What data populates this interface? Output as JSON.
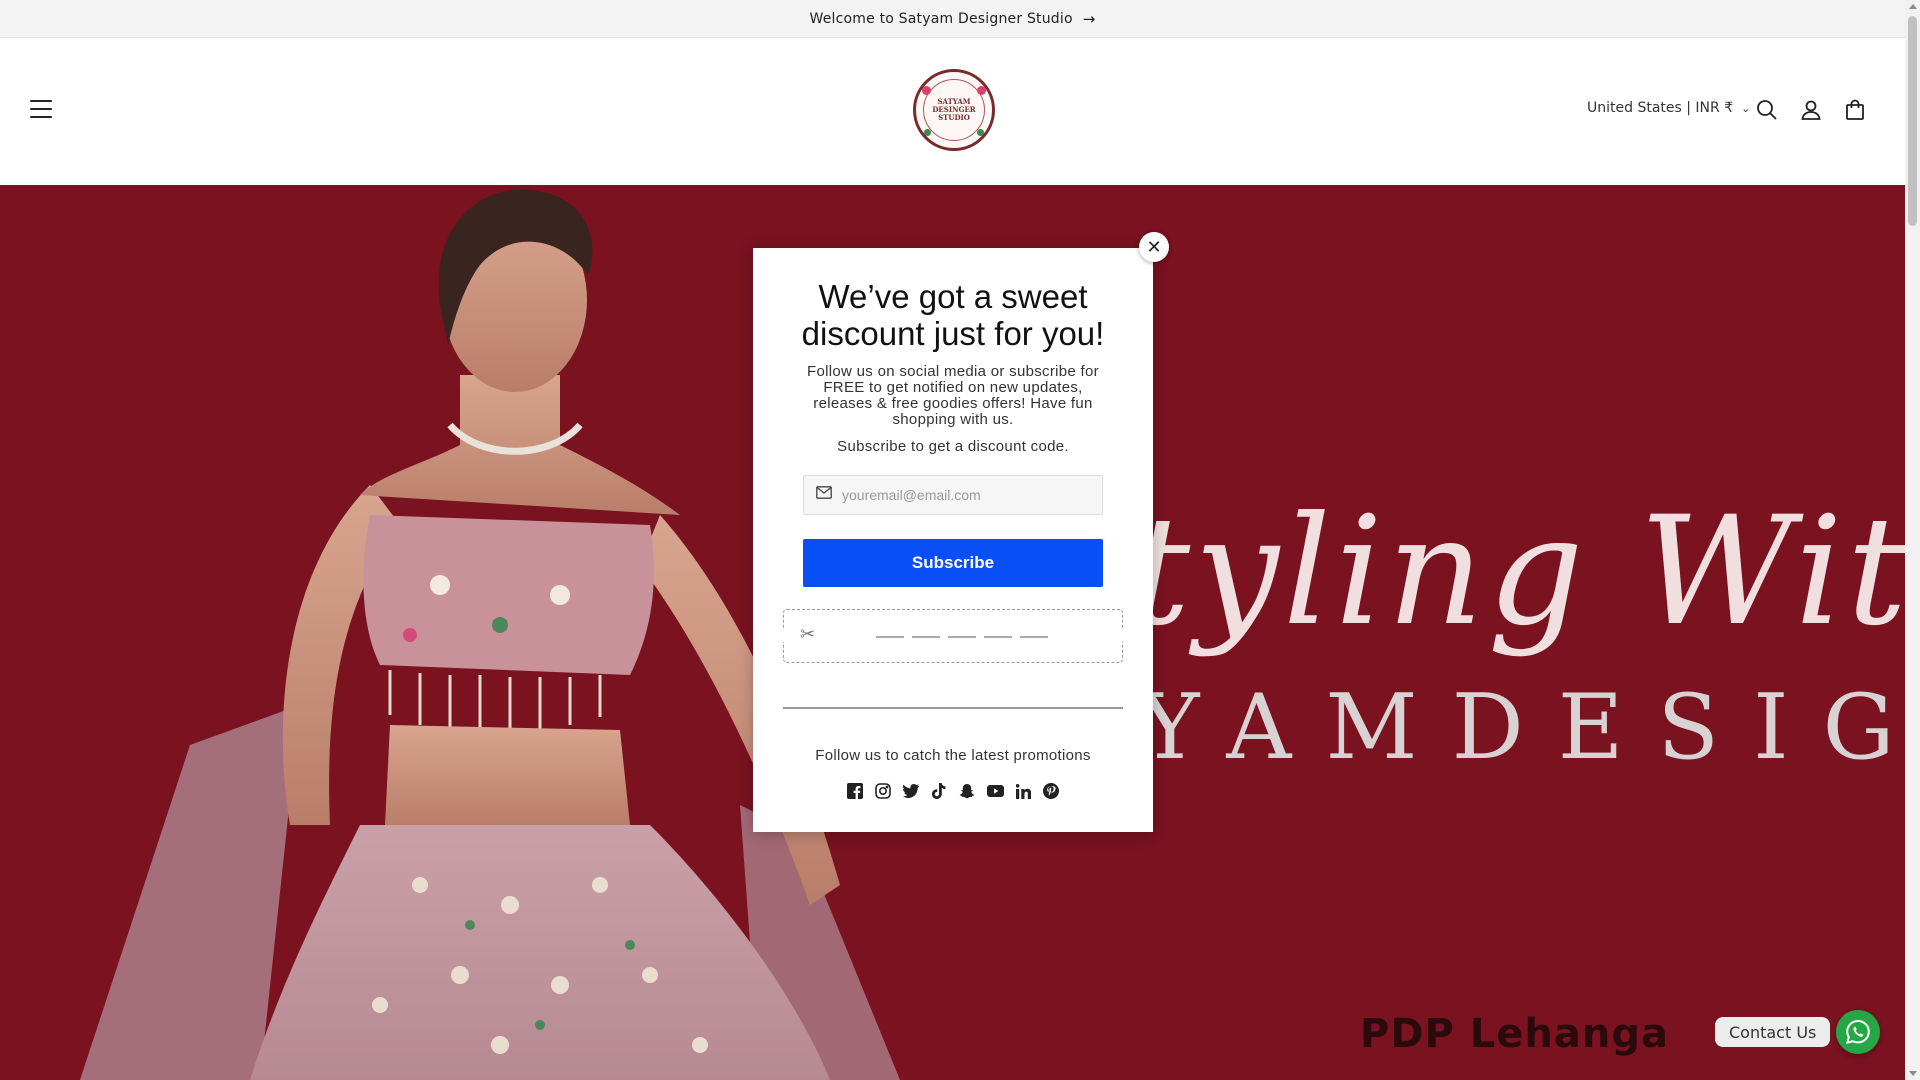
{
  "announcement": {
    "text": "Welcome to Satyam Designer Studio",
    "arrow": "→"
  },
  "header": {
    "menu_icon": "hamburger-menu-icon",
    "logo_text": [
      "SATYAM",
      "DESINGER",
      "STUDIO"
    ],
    "country_selector": "United States | INR ₹",
    "icons": [
      "search-icon",
      "account-icon",
      "cart-icon"
    ]
  },
  "hero": {
    "script_text": "tyling With",
    "brand_text": "YAMDESIGN",
    "caption": "PDP Lehanga",
    "background_color": "#7a1220"
  },
  "popup": {
    "close_symbol": "✕",
    "title": "We’ve got a sweet discount just for you!",
    "description": "Follow us on social media or subscribe for FREE to get notified on new updates, releases & free goodies offers! Have fun shopping with us.",
    "subscribe_prompt": "Subscribe to get a discount code.",
    "email_placeholder": "youremail@email.com",
    "subscribe_label": "Subscribe",
    "coupon_icon": "scissors-icon",
    "follow_text": "Follow us to catch the latest promotions",
    "socials": [
      "facebook-icon",
      "instagram-icon",
      "twitter-icon",
      "tiktok-icon",
      "snapchat-icon",
      "youtube-icon",
      "linkedin-icon",
      "pinterest-icon"
    ],
    "accent_color": "#0a4ef5"
  },
  "whatsapp": {
    "label": "Contact Us",
    "icon": "whatsapp-icon",
    "color": "#25a745"
  }
}
